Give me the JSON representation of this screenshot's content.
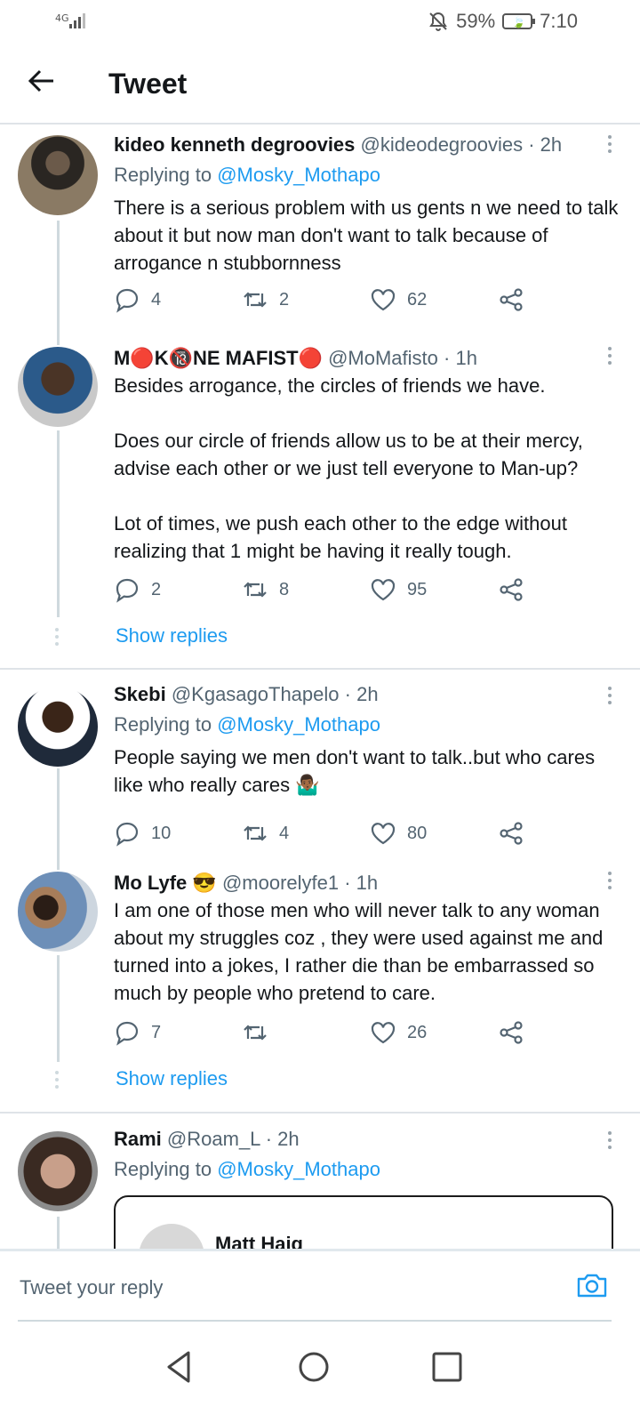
{
  "status_bar": {
    "network": "4G",
    "battery": "59%",
    "time": "7:10"
  },
  "header": {
    "title": "Tweet"
  },
  "tweets": [
    {
      "name": "kideo kenneth degroovies",
      "handle": "@kideodegroovies",
      "time": "· 2h",
      "replying_label": "Replying to",
      "replying_handle": "@Mosky_Mothapo",
      "text": "There is a serious problem with us gents n we need to talk about it but now man don't want to talk because of arrogance n stubbornness",
      "replies": "4",
      "retweets": "2",
      "likes": "62"
    },
    {
      "name": "M🔴K🔞NE MAFIST🔴",
      "handle": "@MoMafisto",
      "time": "· 1h",
      "text": "Besides arrogance, the circles of friends we have.\n\nDoes our circle of friends allow us to be at their mercy, advise each other or we just tell everyone to Man-up?\n\nLot of times, we push each other to the edge without realizing that 1 might be having it really tough.",
      "replies": "2",
      "retweets": "8",
      "likes": "95",
      "show_replies": "Show replies"
    },
    {
      "name": "Skebi",
      "handle": "@KgasagoThapelo",
      "time": "· 2h",
      "replying_label": "Replying to",
      "replying_handle": "@Mosky_Mothapo",
      "text": "People saying we men don't want to talk..but who cares like who really cares 🤷🏾‍♂️",
      "replies": "10",
      "retweets": "4",
      "likes": "80"
    },
    {
      "name": "Mo Lyfe 😎",
      "handle": "@moorelyfe1",
      "time": "· 1h",
      "text": "I am one of those men who will never talk to any woman about my struggles coz , they were used against me and turned into a jokes, I rather die than be embarrassed so much by people who pretend to care.",
      "replies": "7",
      "retweets": "",
      "likes": "26",
      "show_replies": "Show replies"
    },
    {
      "name": "Rami",
      "handle": "@Roam_L",
      "time": "· 2h",
      "replying_label": "Replying to",
      "replying_handle": "@Mosky_Mothapo",
      "quote_name": "Matt Haig"
    }
  ],
  "reply_bar": {
    "placeholder": "Tweet your reply"
  },
  "icons": {
    "reply": "speech-bubble-icon",
    "retweet": "retweet-icon",
    "like": "heart-icon",
    "share": "share-icon",
    "back": "arrow-left-icon",
    "camera": "camera-icon"
  },
  "colors": {
    "accent": "#1d9bf0",
    "text": "#14171a",
    "secondary": "#536471"
  }
}
